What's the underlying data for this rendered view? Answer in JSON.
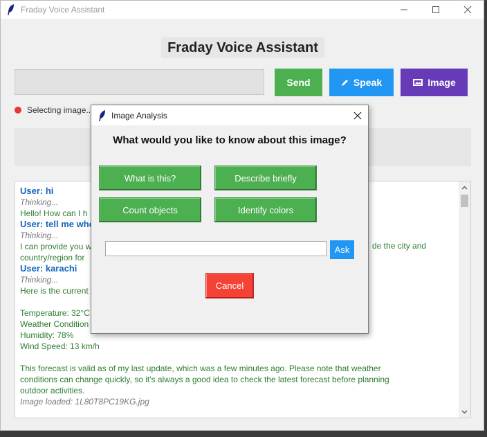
{
  "window": {
    "title": "Fraday Voice Assistant",
    "icon": "feather-icon"
  },
  "header": {
    "heading": "Fraday Voice Assistant"
  },
  "input": {
    "value": "",
    "placeholder": ""
  },
  "toolbar": {
    "send_label": "Send",
    "speak_label": "Speak",
    "speak_icon": "pencil-icon",
    "image_label": "Image",
    "image_icon": "image-icon"
  },
  "status": {
    "text": "Selecting image...",
    "color": "#e53935"
  },
  "chat": {
    "lines": [
      {
        "kind": "user",
        "text": "User: hi"
      },
      {
        "kind": "think",
        "text": "Thinking..."
      },
      {
        "kind": "bot",
        "text": "Hello! How can I h"
      },
      {
        "kind": "user",
        "text": "User: tell me whe"
      },
      {
        "kind": "think",
        "text": "Thinking..."
      },
      {
        "kind": "bot",
        "text": "I can provide you w"
      },
      {
        "kind": "bot",
        "text": "country/region for"
      },
      {
        "kind": "user",
        "text": "User: karachi"
      },
      {
        "kind": "think",
        "text": "Thinking..."
      },
      {
        "kind": "bot",
        "text": "Here is the current"
      },
      {
        "kind": "spacer",
        "text": ""
      },
      {
        "kind": "bot",
        "text": "Temperature: 32°C"
      },
      {
        "kind": "bot",
        "text": "Weather Condition"
      },
      {
        "kind": "bot",
        "text": "Humidity: 78%"
      },
      {
        "kind": "bot",
        "text": "Wind Speed: 13 km/h"
      },
      {
        "kind": "spacer",
        "text": ""
      },
      {
        "kind": "bot",
        "text": "This forecast is valid as of my last update, which was a few minutes ago. Please note that weather"
      },
      {
        "kind": "bot",
        "text": "conditions can change quickly, so it's always a good idea to check the latest forecast before planning"
      },
      {
        "kind": "bot",
        "text": "outdoor activities."
      },
      {
        "kind": "think",
        "text": "Image loaded: 1L80T8PC19KG.jpg"
      }
    ],
    "right_fragment": "de the city and"
  },
  "dialog": {
    "title": "Image Analysis",
    "question": "What would you like to know about this image?",
    "buttons": {
      "what_is_this": "What is this?",
      "describe_briefly": "Describe briefly",
      "count_objects": "Count objects",
      "identify_colors": "Identify colors"
    },
    "custom_input_value": "",
    "ask_label": "Ask",
    "cancel_label": "Cancel"
  },
  "colors": {
    "send": "#4caf50",
    "speak": "#2196f3",
    "image": "#673ab7",
    "cancel": "#f44336",
    "user_text": "#1565c0",
    "bot_text": "#2e7d32"
  }
}
